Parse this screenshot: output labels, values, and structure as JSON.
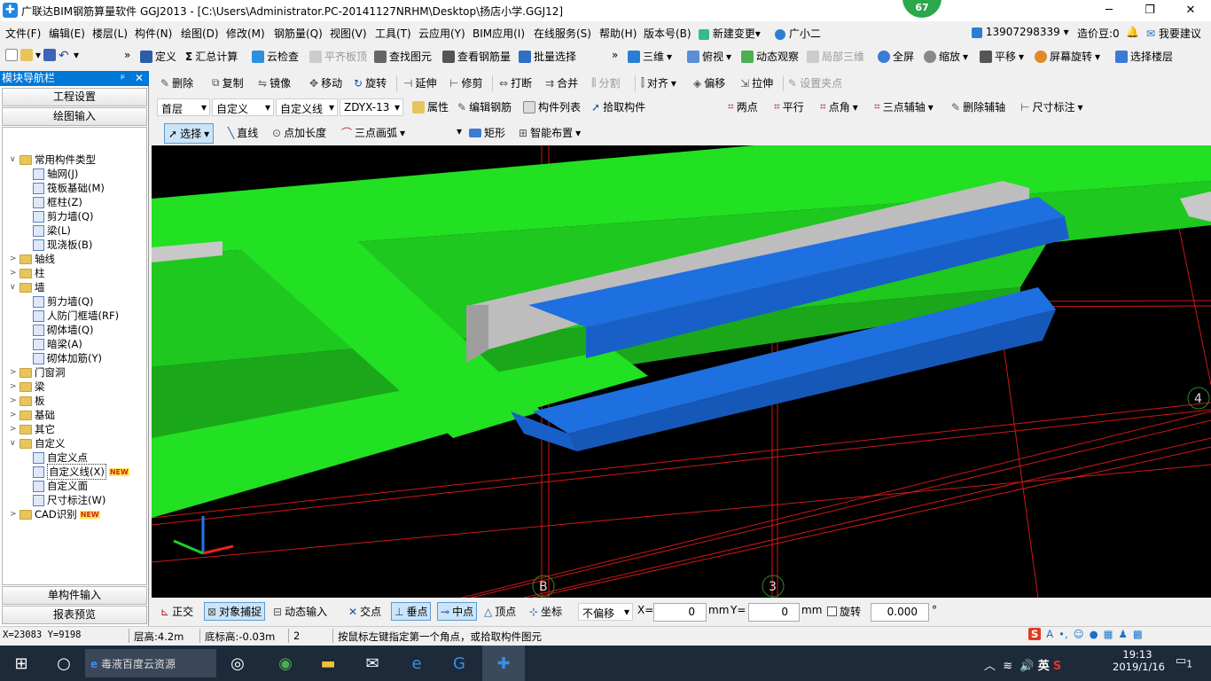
{
  "window": {
    "title": "广联达BIM钢筋算量软件 GGJ2013 - [C:\\Users\\Administrator.PC-20141127NRHM\\Desktop\\扬店小学.GGJ12]",
    "badge": "67",
    "minimize": "─",
    "maximize": "❐",
    "close": "✕"
  },
  "menu": {
    "items": [
      "文件(F)",
      "编辑(E)",
      "楼层(L)",
      "构件(N)",
      "绘图(D)",
      "修改(M)",
      "钢筋量(Q)",
      "视图(V)",
      "工具(T)",
      "云应用(Y)",
      "BIM应用(I)",
      "在线服务(S)",
      "帮助(H)",
      "版本号(B)",
      "新建变更",
      "广小二"
    ],
    "new_change_arrow": "▾",
    "phone": "13907298339",
    "price": "造价豆:0",
    "suggest": "我要建议"
  },
  "toolbar1": {
    "items": [
      "定义",
      "汇总计算",
      "云检查",
      "平齐板顶",
      "查找图元",
      "查看钢筋量",
      "批量选择",
      "三维",
      "俯视",
      "动态观察",
      "局部三维",
      "全屏",
      "缩放",
      "平移",
      "屏幕旋转",
      "选择楼层"
    ]
  },
  "toolbar2": {
    "items": [
      "删除",
      "复制",
      "镜像",
      "移动",
      "旋转",
      "延伸",
      "修剪",
      "打断",
      "合并",
      "分割",
      "对齐",
      "偏移",
      "拉伸",
      "设置夹点"
    ]
  },
  "toolbar3": {
    "floor": "首层",
    "type": "自定义",
    "subtype": "自定义线",
    "name": "ZDYX-13",
    "items": [
      "属性",
      "编辑钢筋",
      "构件列表",
      "拾取构件"
    ],
    "axis_items": [
      "两点",
      "平行",
      "点角",
      "三点辅轴",
      "删除辅轴",
      "尺寸标注"
    ]
  },
  "toolbar4": {
    "items": [
      "选择",
      "直线",
      "点加长度",
      "三点画弧",
      "矩形",
      "智能布置"
    ]
  },
  "nav": {
    "header": "模块导航栏",
    "pin": "ᵖ",
    "close": "✕",
    "btn_setup": "工程设置",
    "btn_draw": "绘图输入",
    "btn_single": "单构件输入",
    "btn_report": "报表预览",
    "expand_icons": "✚ ━",
    "tree": [
      {
        "label": "常用构件类型",
        "level": 0,
        "kind": "folder",
        "exp": "∨"
      },
      {
        "label": "轴网(J)",
        "level": 1,
        "kind": "leaf"
      },
      {
        "label": "筏板基础(M)",
        "level": 1,
        "kind": "leaf"
      },
      {
        "label": "框柱(Z)",
        "level": 1,
        "kind": "leaf"
      },
      {
        "label": "剪力墙(Q)",
        "level": 1,
        "kind": "leaf"
      },
      {
        "label": "梁(L)",
        "level": 1,
        "kind": "leaf"
      },
      {
        "label": "现浇板(B)",
        "level": 1,
        "kind": "leaf"
      },
      {
        "label": "轴线",
        "level": 0,
        "kind": "folder",
        "exp": ">"
      },
      {
        "label": "柱",
        "level": 0,
        "kind": "folder",
        "exp": ">"
      },
      {
        "label": "墙",
        "level": 0,
        "kind": "folder",
        "exp": "∨"
      },
      {
        "label": "剪力墙(Q)",
        "level": 1,
        "kind": "leaf"
      },
      {
        "label": "人防门框墙(RF)",
        "level": 1,
        "kind": "leaf"
      },
      {
        "label": "砌体墙(Q)",
        "level": 1,
        "kind": "leaf"
      },
      {
        "label": "暗梁(A)",
        "level": 1,
        "kind": "leaf"
      },
      {
        "label": "砌体加筋(Y)",
        "level": 1,
        "kind": "leaf"
      },
      {
        "label": "门窗洞",
        "level": 0,
        "kind": "folder",
        "exp": ">"
      },
      {
        "label": "梁",
        "level": 0,
        "kind": "folder",
        "exp": ">"
      },
      {
        "label": "板",
        "level": 0,
        "kind": "folder",
        "exp": ">"
      },
      {
        "label": "基础",
        "level": 0,
        "kind": "folder",
        "exp": ">"
      },
      {
        "label": "其它",
        "level": 0,
        "kind": "folder",
        "exp": ">"
      },
      {
        "label": "自定义",
        "level": 0,
        "kind": "folder",
        "exp": "∨"
      },
      {
        "label": "自定义点",
        "level": 1,
        "kind": "leaf"
      },
      {
        "label": "自定义线(X)",
        "level": 1,
        "kind": "leaf",
        "selected": true,
        "badge": "NEW"
      },
      {
        "label": "自定义面",
        "level": 1,
        "kind": "leaf"
      },
      {
        "label": "尺寸标注(W)",
        "level": 1,
        "kind": "leaf"
      },
      {
        "label": "CAD识别",
        "level": 0,
        "kind": "folder",
        "exp": ">",
        "badge": "NEW"
      }
    ]
  },
  "viewport": {
    "axis_labels": [
      "B",
      "3",
      "4"
    ]
  },
  "snap": {
    "items": [
      "正交",
      "对象捕捉",
      "动态输入",
      "交点",
      "垂点",
      "中点",
      "顶点",
      "坐标"
    ],
    "offset": "不偏移",
    "x_label": "X=",
    "x_val": "0",
    "mm1": "mm",
    "y_label": "Y=",
    "y_val": "0",
    "mm2": "mm",
    "rotate_label": "旋转",
    "rotate_val": "0.000",
    "degree": "°"
  },
  "status": {
    "coords": "X=23083 Y=9198",
    "floor_height": "层高:4.2m",
    "base_height": "底标高:-0.03m",
    "count": "2",
    "hint": "按鼠标左键指定第一个角点，或拾取构件图元"
  },
  "taskbar": {
    "search": "毒液百度云资源",
    "time": "19:13",
    "date": "2019/1/16",
    "notif": "1"
  },
  "colors": {
    "green": "#22e022",
    "blue": "#1e6fe0",
    "gray": "#bdbdbd",
    "grid": "#d01818"
  }
}
